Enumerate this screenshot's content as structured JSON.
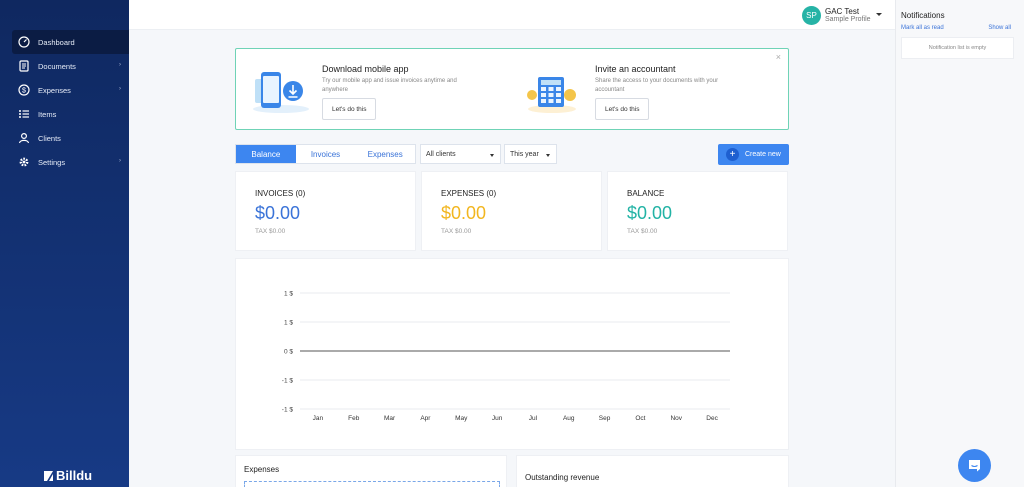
{
  "sidebar": {
    "items": [
      {
        "label": "Dashboard",
        "icon": "gauge-icon",
        "active": true
      },
      {
        "label": "Documents",
        "icon": "document-icon",
        "arrow": "›"
      },
      {
        "label": "Expenses",
        "icon": "dollar-icon",
        "arrow": "›"
      },
      {
        "label": "Items",
        "icon": "list-icon"
      },
      {
        "label": "Clients",
        "icon": "user-icon"
      },
      {
        "label": "Settings",
        "icon": "gear-icon",
        "arrow": "›"
      }
    ],
    "brand": "Billdu"
  },
  "profile": {
    "initials": "SP",
    "name": "GAC Test",
    "subtitle": "Sample Profile"
  },
  "notifications": {
    "title": "Notifications",
    "mark_all": "Mark all as read",
    "show_all": "Show all",
    "empty": "Notification list is empty"
  },
  "promo": {
    "close": "×",
    "mobile": {
      "title": "Download mobile app",
      "text": "Try our mobile app and issue invoices anytime and anywhere",
      "button": "Let's do this"
    },
    "accountant": {
      "title": "Invite an accountant",
      "text": "Share the access to your documents with your accountant",
      "button": "Let's do this"
    }
  },
  "tabs": [
    {
      "label": "Balance",
      "active": true
    },
    {
      "label": "Invoices"
    },
    {
      "label": "Expenses"
    }
  ],
  "filters": {
    "clients": "All clients",
    "period": "This year"
  },
  "create_button": "Create new",
  "cards": [
    {
      "label": "INVOICES (0)",
      "value": "$0.00",
      "tax": "TAX $0.00",
      "color": "#3a73d8"
    },
    {
      "label": "EXPENSES (0)",
      "value": "$0.00",
      "tax": "TAX $0.00",
      "color": "#f2b61f"
    },
    {
      "label": "BALANCE",
      "value": "$0.00",
      "tax": "TAX $0.00",
      "color": "#22b3a5"
    }
  ],
  "chart_data": {
    "type": "line",
    "categories": [
      "Jan",
      "Feb",
      "Mar",
      "Apr",
      "May",
      "Jun",
      "Jul",
      "Aug",
      "Sep",
      "Oct",
      "Nov",
      "Dec"
    ],
    "series": [
      {
        "values": [
          0,
          0,
          0,
          0,
          0,
          0,
          0,
          0,
          0,
          0,
          0,
          0
        ]
      }
    ],
    "y_ticks": [
      "1 $",
      "1 $",
      "0 $",
      "-1 $",
      "-1 $"
    ],
    "ylim": [
      -1,
      1
    ],
    "grid": true
  },
  "bottom": {
    "expenses": "Expenses",
    "outstanding": "Outstanding revenue"
  },
  "colors": {
    "accent": "#3d86f0",
    "sidebar": "#0f2860",
    "teal": "#22b3a5"
  }
}
